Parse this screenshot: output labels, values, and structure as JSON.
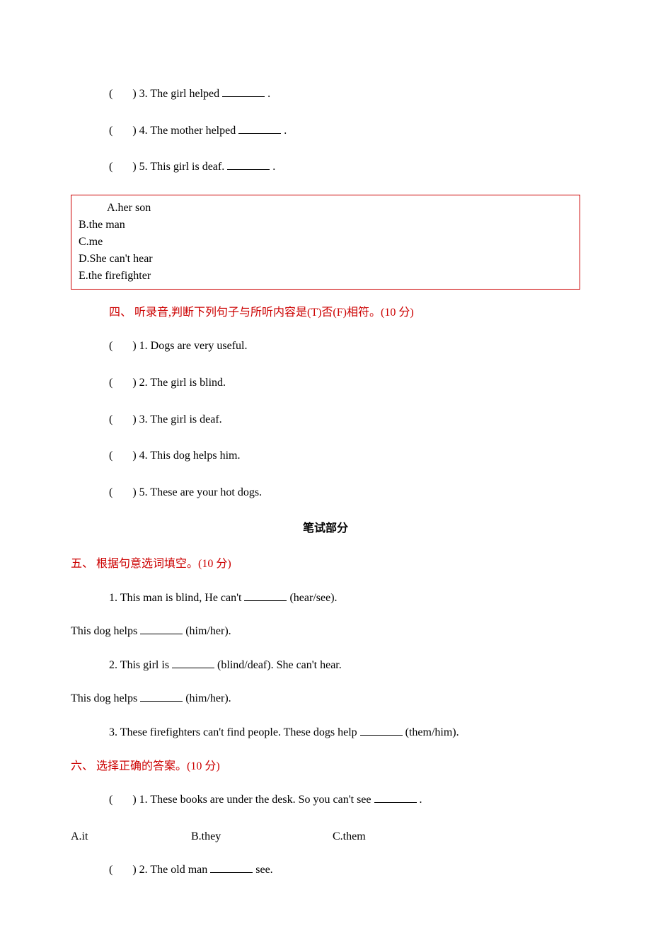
{
  "paren_open": "(",
  "paren_close": ")",
  "section3_items": {
    "q3": "3. The girl helped",
    "q3_end": ".",
    "q4": "4. The mother helped",
    "q4_end": ".",
    "q5": "5. This girl is deaf. ",
    "q5_end": "."
  },
  "options_box": {
    "a": "A.her son",
    "b": "B.the man",
    "c": "C.me",
    "d": "D.She can't hear",
    "e": "E.the firefighter"
  },
  "section4": {
    "header": "四、 听录音,判断下列句子与所听内容是(T)否(F)相符。(10 分)",
    "q1": "1. Dogs are very useful.",
    "q2": "2. The girl is blind.",
    "q3": "3. The girl is deaf.",
    "q4": "4. This dog helps him.",
    "q5": "5. These are your hot dogs."
  },
  "written_title": "笔试部分",
  "section5": {
    "header": "五、 根据句意选词填空。(10 分)",
    "q1_a": "1. This man is blind, He can't ",
    "q1_b": "(hear/see).",
    "q1_line2_a": "This dog helps",
    "q1_line2_b": "(him/her).",
    "q2_a": "2. This girl is ",
    "q2_b": "(blind/deaf). She can't hear.",
    "q2_line2_a": "This dog helps",
    "q2_line2_b": " (him/her).",
    "q3_a": "3. These firefighters can't find people. These dogs help ",
    "q3_b": "(them/him)."
  },
  "section6": {
    "header": "六、 选择正确的答案。(10 分)",
    "q1_a": "1. These books are under the desk. So you can't see ",
    "q1_b": ".",
    "q1_choices": {
      "a": "A.it",
      "b": "B.they",
      "c": "C.them"
    },
    "q2_a": "2. The old man ",
    "q2_b": "see."
  }
}
